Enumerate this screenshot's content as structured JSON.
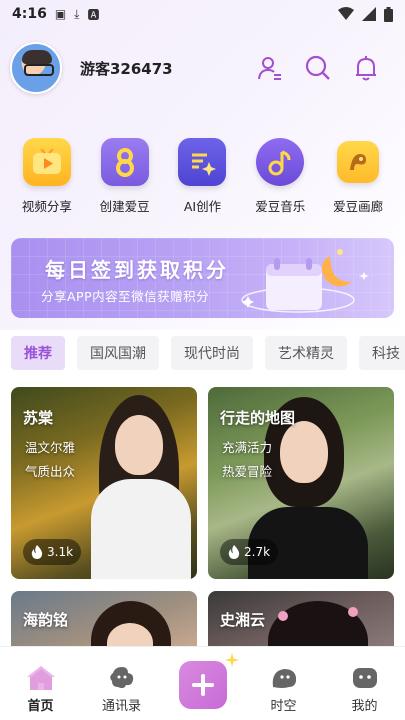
{
  "status_bar": {
    "time": "4:16"
  },
  "user": {
    "name": "游客326473"
  },
  "features": [
    {
      "label": "视频分享",
      "icon": "video-share-icon"
    },
    {
      "label": "创建爱豆",
      "icon": "create-idol-icon"
    },
    {
      "label": "AI创作",
      "icon": "ai-create-icon"
    },
    {
      "label": "爱豆音乐",
      "icon": "music-icon"
    },
    {
      "label": "爱豆画廊",
      "icon": "gallery-icon"
    }
  ],
  "banner": {
    "title": "每日签到获取积分",
    "subtitle": "分享APP内容至微信获赠积分"
  },
  "tabs": [
    "推荐",
    "国风国潮",
    "现代时尚",
    "艺术精灵",
    "科技"
  ],
  "cards": [
    {
      "name": "苏棠",
      "tags": [
        "温文尔雅",
        "气质出众"
      ],
      "likes": "3.1k"
    },
    {
      "name": "行走的地图",
      "tags": [
        "充满活力",
        "热爱冒险"
      ],
      "likes": "2.7k"
    },
    {
      "name": "海韵铭",
      "tags": [],
      "likes": ""
    },
    {
      "name": "史湘云",
      "tags": [],
      "likes": ""
    }
  ],
  "nav": {
    "home": "首页",
    "contacts": "通讯录",
    "time": "时空",
    "mine": "我的"
  },
  "colors": {
    "accent": "#9a52d8",
    "plus": "#d47ddc"
  }
}
